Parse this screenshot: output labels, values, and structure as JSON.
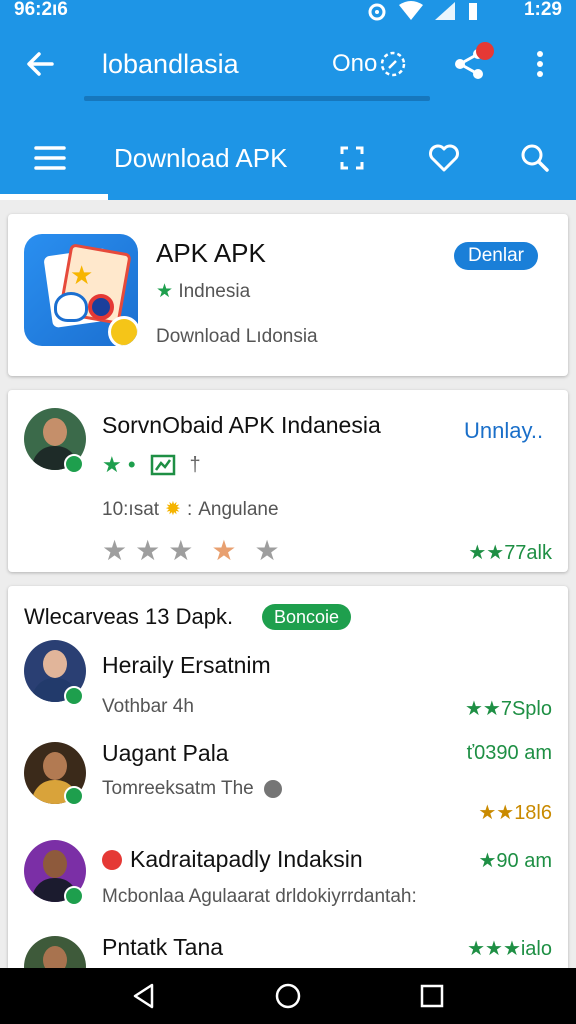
{
  "status": {
    "time_left": "96:2ı6",
    "time_right": "1:29"
  },
  "appbar": {
    "title": "lobandlasia",
    "online_label": "Ono"
  },
  "tabs": {
    "active_label": "Download APK"
  },
  "card1": {
    "title": "APK APK",
    "badge": "Denlar",
    "rating_text": "Indnesia",
    "subtitle": "Download Lıdonsia"
  },
  "card2": {
    "title": "SorvnObaid APK Indanesia",
    "action": "Unnlay..",
    "meta": "10:ısat",
    "meta2": "Angulane",
    "stat": "★★77alk"
  },
  "card3": {
    "header": "Wlecarveas 13 Dapk.",
    "badge": "Boncoie",
    "items": [
      {
        "name": "Heraily Ersatnim",
        "sub": "Vothbar 4h",
        "stat": "★★7Splo"
      },
      {
        "name": "Uagant Pala",
        "sub": "Tomreeksatm The",
        "stat": "ť0390 am",
        "stat2": "★★18l6"
      },
      {
        "name": "Kadraitapadly Indaksin",
        "sub": "Mcbonlaa Agulaarat drldokiyrrdantah:",
        "stat": "★90 am"
      },
      {
        "name": "Pntatk Tana",
        "stat": "★★★ialo"
      }
    ]
  },
  "colors": {
    "primary": "#1e95e6",
    "accent_green": "#1e9f4d",
    "badge_blue": "#1a7fd8"
  }
}
